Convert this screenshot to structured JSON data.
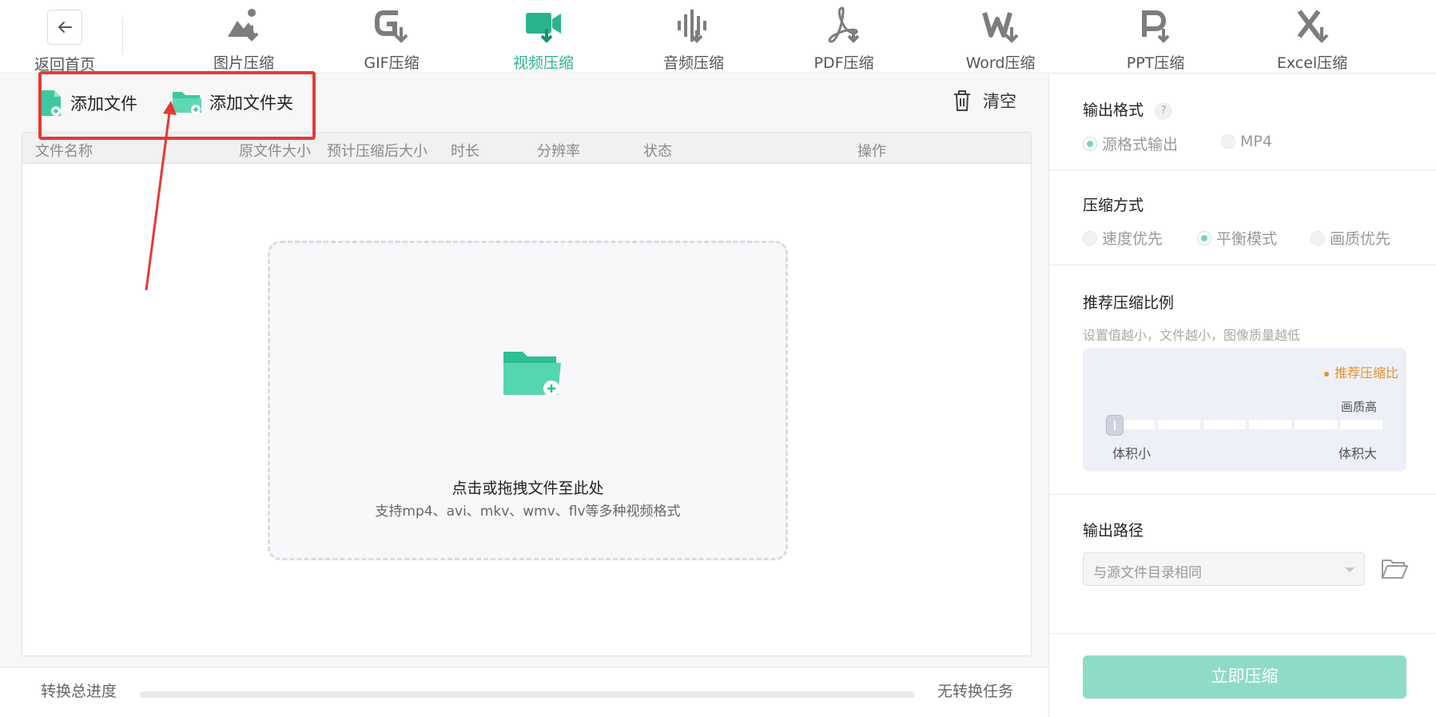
{
  "nav": {
    "back_label": "返回首页",
    "items": [
      {
        "label": "图片压缩",
        "icon": "image-compress-icon"
      },
      {
        "label": "GIF压缩",
        "icon": "gif-compress-icon"
      },
      {
        "label": "视频压缩",
        "icon": "video-compress-icon"
      },
      {
        "label": "音频压缩",
        "icon": "audio-compress-icon"
      },
      {
        "label": "PDF压缩",
        "icon": "pdf-compress-icon"
      },
      {
        "label": "Word压缩",
        "icon": "word-compress-icon"
      },
      {
        "label": "PPT压缩",
        "icon": "ppt-compress-icon"
      },
      {
        "label": "Excel压缩",
        "icon": "excel-compress-icon"
      }
    ],
    "active": "视频压缩"
  },
  "toolbar": {
    "add_file": "添加文件",
    "add_folder": "添加文件夹",
    "clear": "清空"
  },
  "table": {
    "columns": [
      "文件名称",
      "原文件大小",
      "预计压缩后大小",
      "时长",
      "分辨率",
      "状态",
      "操作"
    ]
  },
  "dropzone": {
    "title": "点击或拖拽文件至此处",
    "subtitle": "支持mp4、avi、mkv、wmv、flv等多种视频格式"
  },
  "progress": {
    "label": "转换总进度",
    "value": 0,
    "status": "无转换任务"
  },
  "settings": {
    "output_format": {
      "title": "输出格式",
      "help": "?",
      "options": [
        "源格式输出",
        "MP4"
      ],
      "selected": "源格式输出"
    },
    "compress_mode": {
      "title": "压缩方式",
      "options": [
        "速度优先",
        "平衡模式",
        "画质优先"
      ],
      "selected": "平衡模式"
    },
    "ratio": {
      "title": "推荐压缩比例",
      "hint": "设置值越小，文件越小，图像质量越低",
      "recommended_label": "推荐压缩比",
      "high_quality_label": "画质高",
      "min_label": "体积小",
      "max_label": "体积大",
      "segments": 6,
      "value": 0
    },
    "output_path": {
      "title": "输出路径",
      "selected": "与源文件目录相同"
    },
    "start_button": "立即压缩"
  },
  "colors": {
    "accent": "#2bb390",
    "annotation": "#e53935",
    "recommend": "#e8912d"
  }
}
